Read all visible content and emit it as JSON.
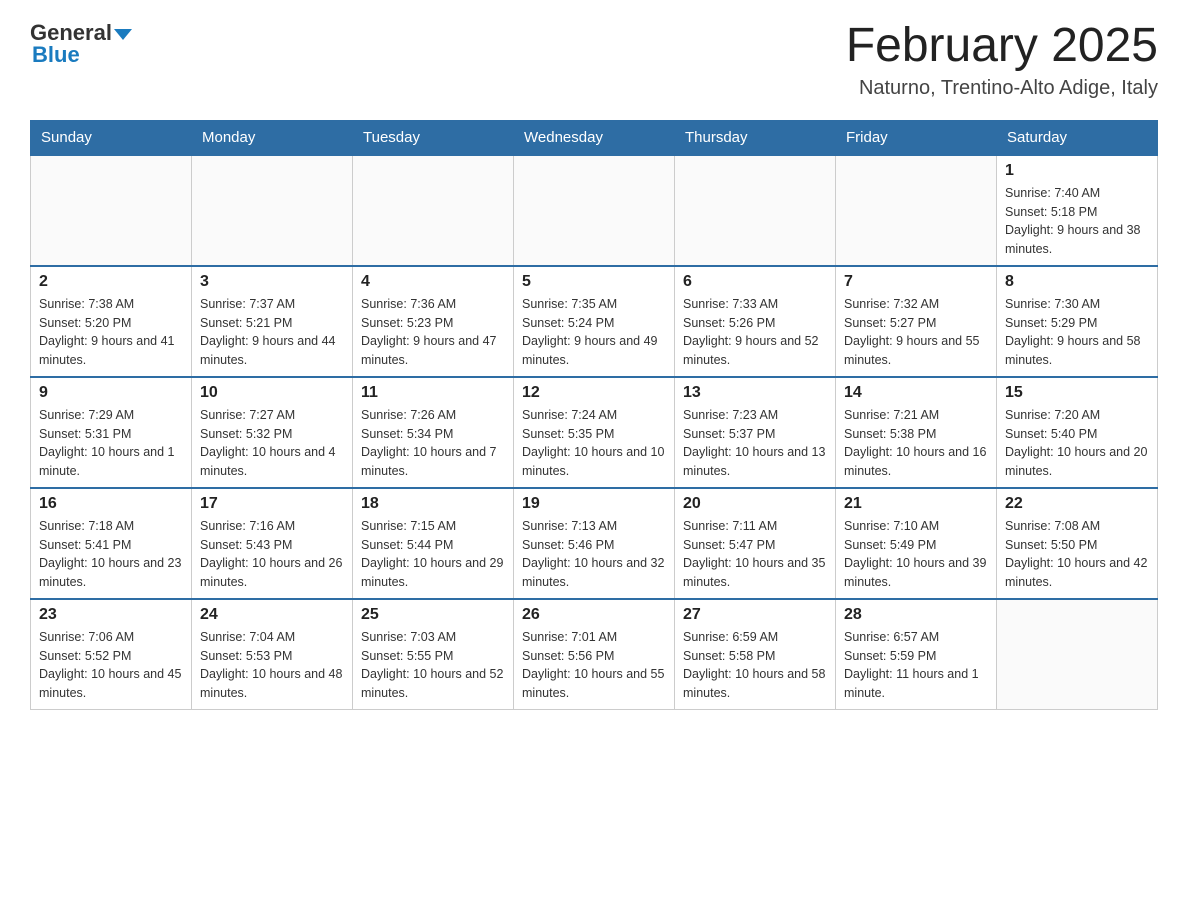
{
  "header": {
    "logo_general": "General",
    "logo_blue": "Blue",
    "month_title": "February 2025",
    "location": "Naturno, Trentino-Alto Adige, Italy"
  },
  "weekdays": [
    "Sunday",
    "Monday",
    "Tuesday",
    "Wednesday",
    "Thursday",
    "Friday",
    "Saturday"
  ],
  "weeks": [
    [
      {
        "day": "",
        "info": ""
      },
      {
        "day": "",
        "info": ""
      },
      {
        "day": "",
        "info": ""
      },
      {
        "day": "",
        "info": ""
      },
      {
        "day": "",
        "info": ""
      },
      {
        "day": "",
        "info": ""
      },
      {
        "day": "1",
        "info": "Sunrise: 7:40 AM\nSunset: 5:18 PM\nDaylight: 9 hours and 38 minutes."
      }
    ],
    [
      {
        "day": "2",
        "info": "Sunrise: 7:38 AM\nSunset: 5:20 PM\nDaylight: 9 hours and 41 minutes."
      },
      {
        "day": "3",
        "info": "Sunrise: 7:37 AM\nSunset: 5:21 PM\nDaylight: 9 hours and 44 minutes."
      },
      {
        "day": "4",
        "info": "Sunrise: 7:36 AM\nSunset: 5:23 PM\nDaylight: 9 hours and 47 minutes."
      },
      {
        "day": "5",
        "info": "Sunrise: 7:35 AM\nSunset: 5:24 PM\nDaylight: 9 hours and 49 minutes."
      },
      {
        "day": "6",
        "info": "Sunrise: 7:33 AM\nSunset: 5:26 PM\nDaylight: 9 hours and 52 minutes."
      },
      {
        "day": "7",
        "info": "Sunrise: 7:32 AM\nSunset: 5:27 PM\nDaylight: 9 hours and 55 minutes."
      },
      {
        "day": "8",
        "info": "Sunrise: 7:30 AM\nSunset: 5:29 PM\nDaylight: 9 hours and 58 minutes."
      }
    ],
    [
      {
        "day": "9",
        "info": "Sunrise: 7:29 AM\nSunset: 5:31 PM\nDaylight: 10 hours and 1 minute."
      },
      {
        "day": "10",
        "info": "Sunrise: 7:27 AM\nSunset: 5:32 PM\nDaylight: 10 hours and 4 minutes."
      },
      {
        "day": "11",
        "info": "Sunrise: 7:26 AM\nSunset: 5:34 PM\nDaylight: 10 hours and 7 minutes."
      },
      {
        "day": "12",
        "info": "Sunrise: 7:24 AM\nSunset: 5:35 PM\nDaylight: 10 hours and 10 minutes."
      },
      {
        "day": "13",
        "info": "Sunrise: 7:23 AM\nSunset: 5:37 PM\nDaylight: 10 hours and 13 minutes."
      },
      {
        "day": "14",
        "info": "Sunrise: 7:21 AM\nSunset: 5:38 PM\nDaylight: 10 hours and 16 minutes."
      },
      {
        "day": "15",
        "info": "Sunrise: 7:20 AM\nSunset: 5:40 PM\nDaylight: 10 hours and 20 minutes."
      }
    ],
    [
      {
        "day": "16",
        "info": "Sunrise: 7:18 AM\nSunset: 5:41 PM\nDaylight: 10 hours and 23 minutes."
      },
      {
        "day": "17",
        "info": "Sunrise: 7:16 AM\nSunset: 5:43 PM\nDaylight: 10 hours and 26 minutes."
      },
      {
        "day": "18",
        "info": "Sunrise: 7:15 AM\nSunset: 5:44 PM\nDaylight: 10 hours and 29 minutes."
      },
      {
        "day": "19",
        "info": "Sunrise: 7:13 AM\nSunset: 5:46 PM\nDaylight: 10 hours and 32 minutes."
      },
      {
        "day": "20",
        "info": "Sunrise: 7:11 AM\nSunset: 5:47 PM\nDaylight: 10 hours and 35 minutes."
      },
      {
        "day": "21",
        "info": "Sunrise: 7:10 AM\nSunset: 5:49 PM\nDaylight: 10 hours and 39 minutes."
      },
      {
        "day": "22",
        "info": "Sunrise: 7:08 AM\nSunset: 5:50 PM\nDaylight: 10 hours and 42 minutes."
      }
    ],
    [
      {
        "day": "23",
        "info": "Sunrise: 7:06 AM\nSunset: 5:52 PM\nDaylight: 10 hours and 45 minutes."
      },
      {
        "day": "24",
        "info": "Sunrise: 7:04 AM\nSunset: 5:53 PM\nDaylight: 10 hours and 48 minutes."
      },
      {
        "day": "25",
        "info": "Sunrise: 7:03 AM\nSunset: 5:55 PM\nDaylight: 10 hours and 52 minutes."
      },
      {
        "day": "26",
        "info": "Sunrise: 7:01 AM\nSunset: 5:56 PM\nDaylight: 10 hours and 55 minutes."
      },
      {
        "day": "27",
        "info": "Sunrise: 6:59 AM\nSunset: 5:58 PM\nDaylight: 10 hours and 58 minutes."
      },
      {
        "day": "28",
        "info": "Sunrise: 6:57 AM\nSunset: 5:59 PM\nDaylight: 11 hours and 1 minute."
      },
      {
        "day": "",
        "info": ""
      }
    ]
  ]
}
